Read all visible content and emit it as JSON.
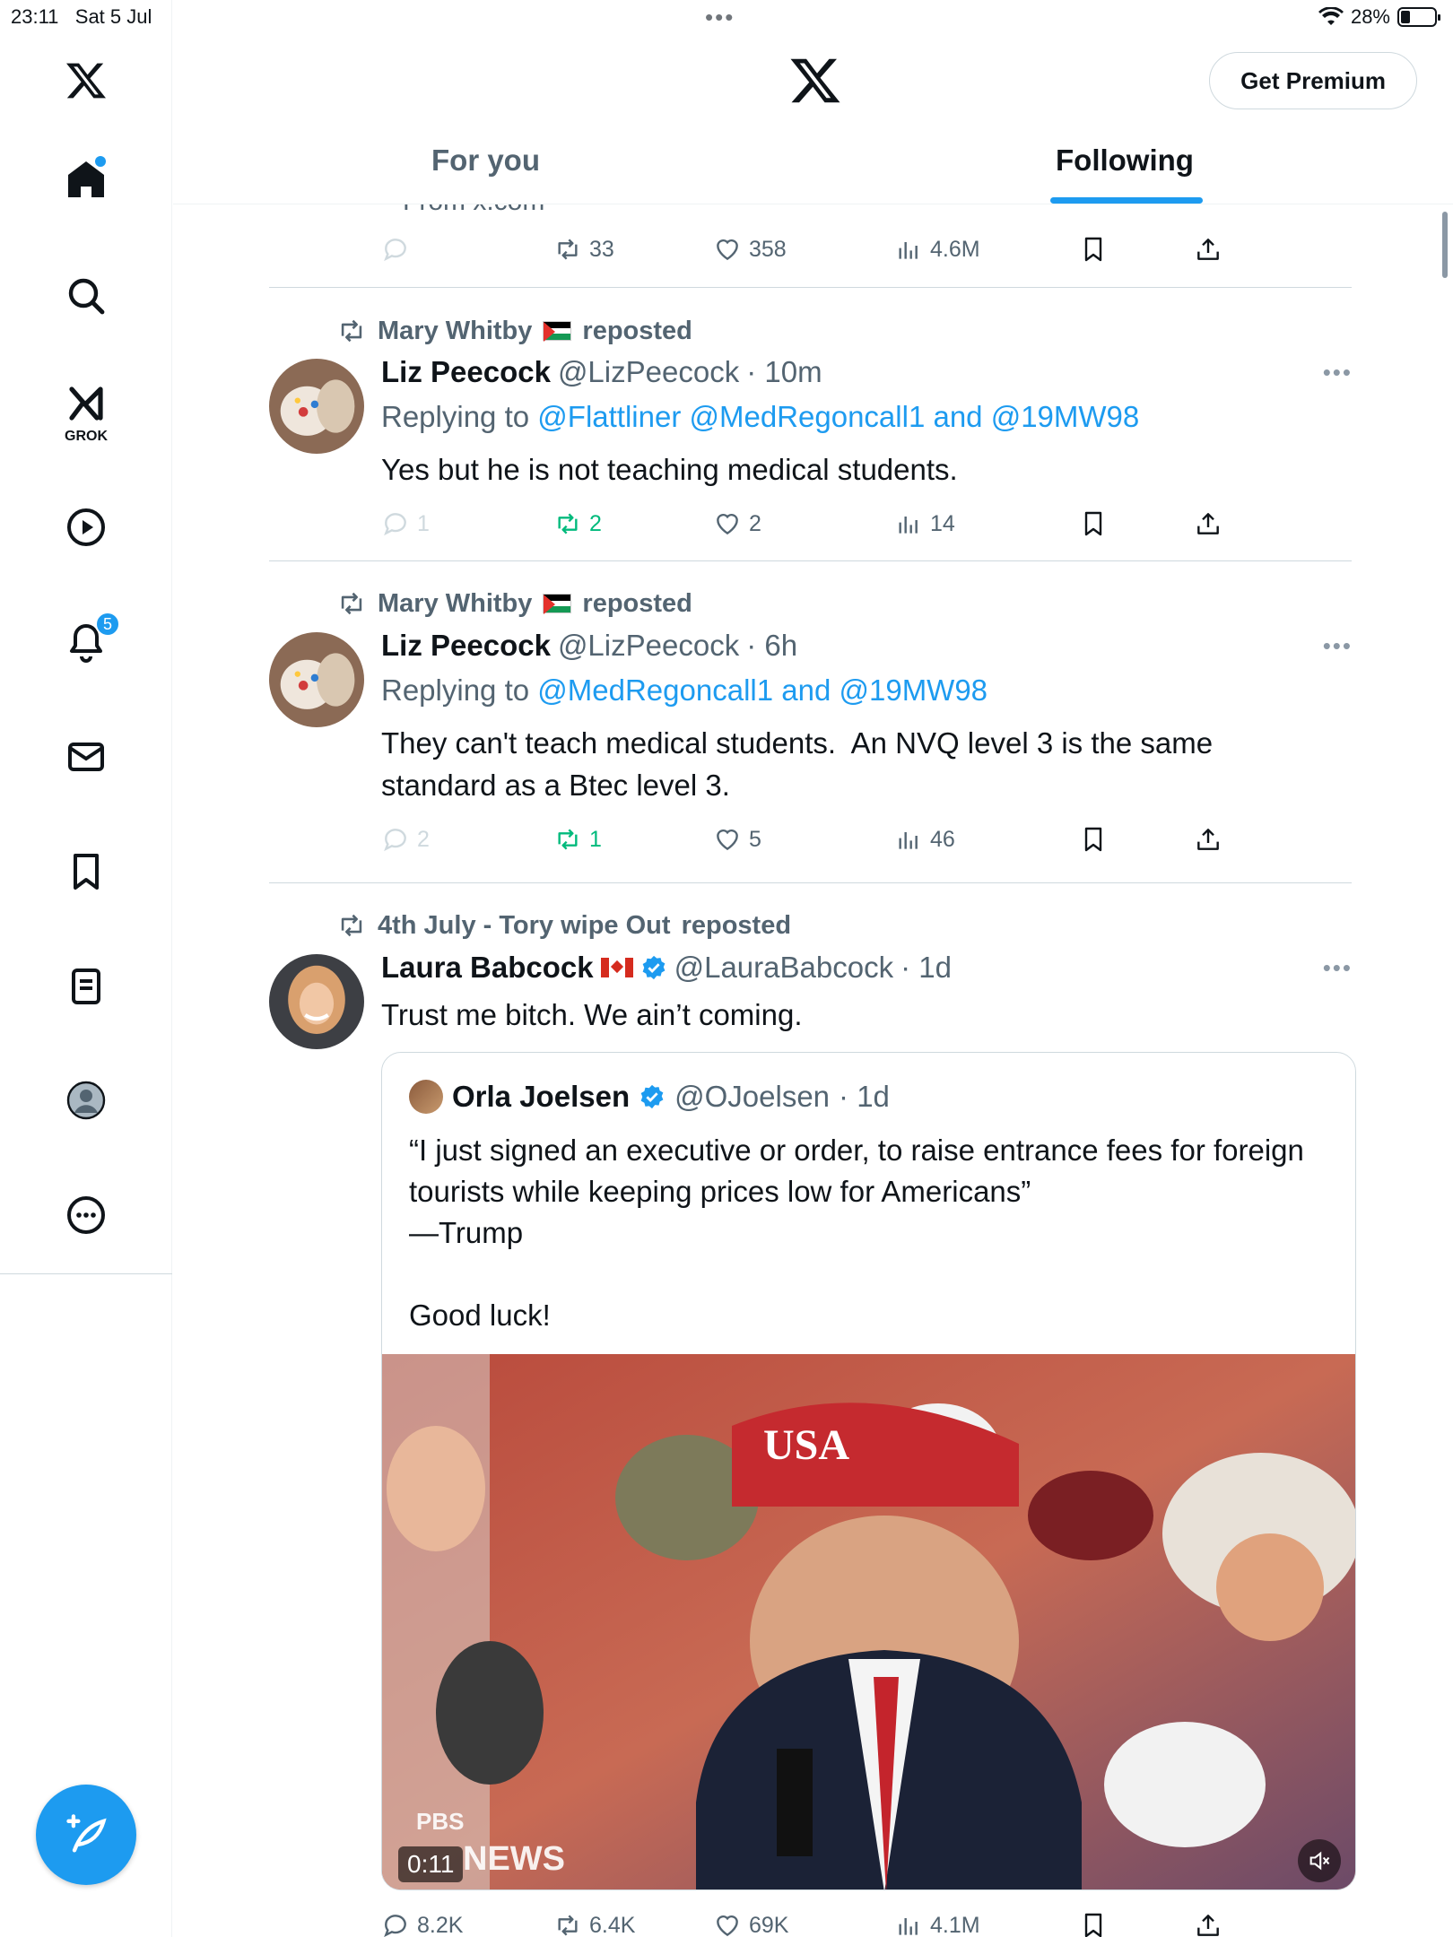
{
  "status_bar": {
    "time": "23:11",
    "date": "Sat 5 Jul",
    "battery": "28%",
    "battery_fraction": 0.28
  },
  "sidebar": {
    "notifications_badge": "5",
    "grok_label": "GROK",
    "items": [
      {
        "name": "x-logo-icon"
      },
      {
        "name": "home-icon"
      },
      {
        "name": "search-icon"
      },
      {
        "name": "grok-icon"
      },
      {
        "name": "video-icon"
      },
      {
        "name": "notifications-icon"
      },
      {
        "name": "messages-icon"
      },
      {
        "name": "bookmarks-icon"
      },
      {
        "name": "lists-icon"
      },
      {
        "name": "profile-icon"
      },
      {
        "name": "more-icon"
      }
    ]
  },
  "header": {
    "premium_label": "Get Premium",
    "tabs": [
      {
        "label": "For you",
        "active": false
      },
      {
        "label": "Following",
        "active": true
      }
    ]
  },
  "accent_color": "#1d9bf0",
  "feed": {
    "partial_text": "From x.com",
    "top_actions": {
      "replies": "",
      "reposts": "33",
      "likes": "358",
      "views": "4.6M"
    },
    "posts": [
      {
        "reposted_by": "Mary Whitby",
        "reposted_suffix": "reposted",
        "name": "Liz Peecock",
        "handle": "@LizPeecock",
        "time": "· 10m",
        "replying_prefix": "Replying to",
        "replying_to": "@Flattliner @MedRegoncall1 and @19MW98",
        "text": "Yes but he is not teaching medical students.",
        "actions": {
          "replies": "1",
          "reposts": "2",
          "likes": "2",
          "views": "14"
        }
      },
      {
        "reposted_by": "Mary Whitby",
        "reposted_suffix": "reposted",
        "name": "Liz Peecock",
        "handle": "@LizPeecock",
        "time": "· 6h",
        "replying_prefix": "Replying to",
        "replying_to": "@MedRegoncall1 and @19MW98",
        "text": "They can't teach medical students.  An NVQ level 3 is the same standard as a Btec level 3.",
        "actions": {
          "replies": "2",
          "reposts": "1",
          "likes": "5",
          "views": "46"
        }
      },
      {
        "reposted_by": "4th July - Tory wipe Out",
        "reposted_suffix": "reposted",
        "name": "Laura Babcock",
        "handle": "@LauraBabcock",
        "time": "· 1d",
        "text": "Trust me bitch. We ain’t coming.",
        "quote": {
          "name": "Orla Joelsen",
          "handle": "@OJoelsen",
          "time": "· 1d",
          "text": "“I just signed an executive or order, to raise entrance fees for foreign tourists while keeping prices low for Americans”\n—Trump\n\nGood luck!",
          "video": {
            "duration": "0:11",
            "watermark": "PBS",
            "watermark_2": "NEWS",
            "hat_text": "USA"
          }
        },
        "actions": {
          "replies": "8.2K",
          "reposts": "6.4K",
          "likes": "69K",
          "views": "4.1M"
        }
      }
    ]
  }
}
